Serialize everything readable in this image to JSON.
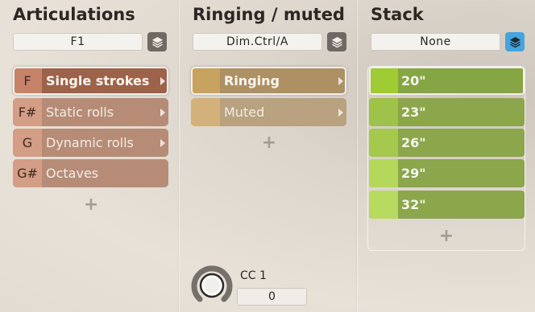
{
  "articulations": {
    "title": "Articulations",
    "selector": "F1",
    "rows": [
      {
        "key": "F",
        "label": "Single strokes",
        "has_arrow": true,
        "selected": true
      },
      {
        "key": "F#",
        "label": "Static rolls",
        "has_arrow": true,
        "selected": false
      },
      {
        "key": "G",
        "label": "Dynamic rolls",
        "has_arrow": true,
        "selected": false
      },
      {
        "key": "G#",
        "label": "Octaves",
        "has_arrow": false,
        "selected": false
      }
    ],
    "add": "+"
  },
  "ringing": {
    "title": "Ringing / muted",
    "selector": "Dim.Ctrl/A",
    "rows": [
      {
        "label": "Ringing",
        "has_arrow": true,
        "selected": true
      },
      {
        "label": "Muted",
        "has_arrow": true,
        "selected": false
      }
    ],
    "add": "+",
    "cc_label": "CC 1",
    "cc_value": "0"
  },
  "stack": {
    "title": "Stack",
    "selector": "None",
    "rows": [
      {
        "label": "20\"",
        "selected": true
      },
      {
        "label": "23\"",
        "selected": false
      },
      {
        "label": "26\"",
        "selected": false
      },
      {
        "label": "29\"",
        "selected": false
      },
      {
        "label": "32\"",
        "selected": false
      }
    ],
    "add": "+"
  },
  "colors": {
    "articulation_row": "#b78d76",
    "articulation_selected": "#9f6147",
    "articulation_key": "#d39a80",
    "ringing_row": "#b39a74",
    "ringing_key": "#d2a867",
    "stack_row": "#8aa64e",
    "stack_key_selected": "#8cc934",
    "stack_key": "#a7cf55",
    "stack_active_button": "#46a4dd"
  },
  "icons": {
    "stack_button": "layers-icon",
    "row_arrow": "chevron-right-icon"
  }
}
